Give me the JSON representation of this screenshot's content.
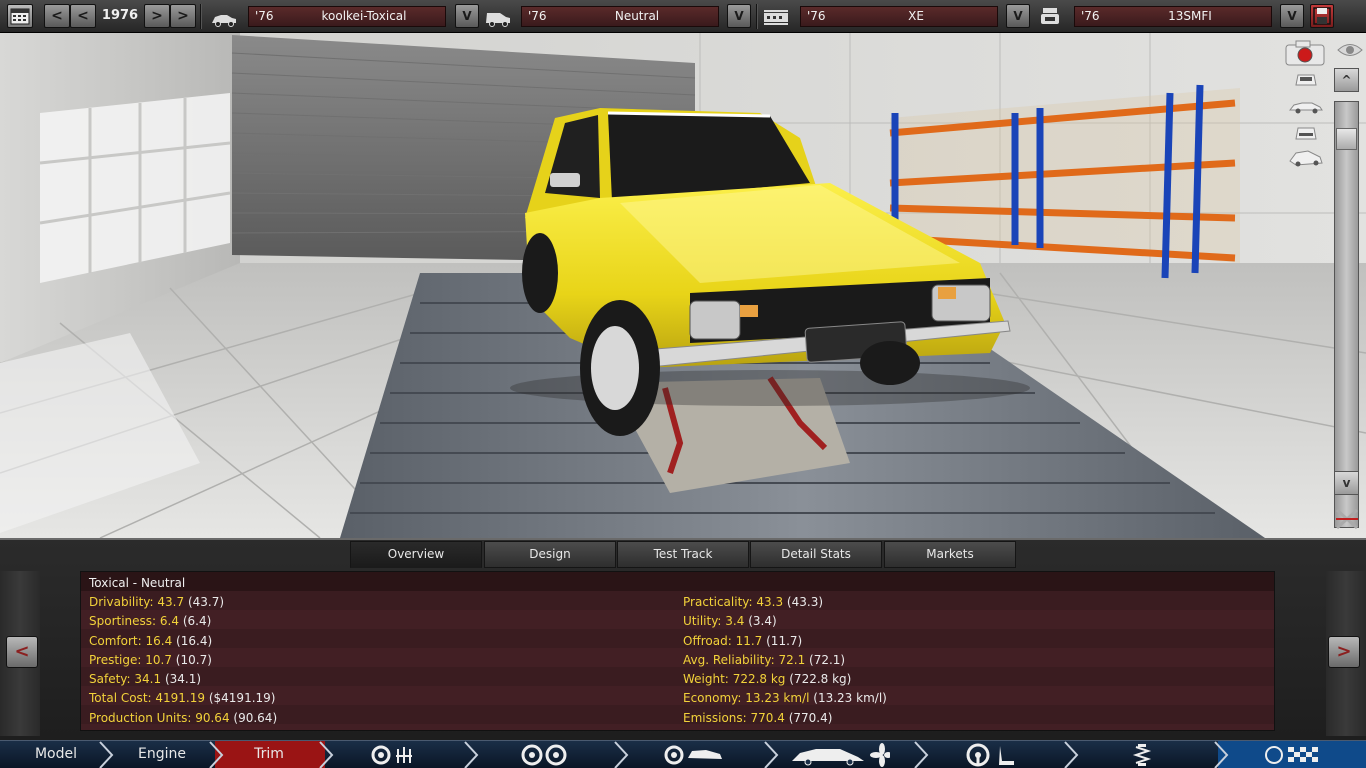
{
  "topbar": {
    "year": "1976",
    "prev_fast": "<",
    "prev": "<",
    "next": ">",
    "next_fast": ">",
    "dropdown": "V",
    "fields": [
      {
        "year": "'76",
        "name": "koolkei-Toxical"
      },
      {
        "year": "'76",
        "name": "Neutral"
      },
      {
        "year": "'76",
        "name": "XE"
      },
      {
        "year": "'76",
        "name": "13SMFI"
      }
    ]
  },
  "scene": {
    "scroll_up": "^",
    "scroll_down": "v"
  },
  "tabs": [
    "Overview",
    "Design",
    "Test Track",
    "Detail Stats",
    "Markets"
  ],
  "active_tab": "Overview",
  "stats": {
    "title": "Toxical - Neutral",
    "left": [
      {
        "label": "Drivability:",
        "value": "43.7",
        "paren": "(43.7)"
      },
      {
        "label": "Sportiness:",
        "value": "6.4",
        "paren": "(6.4)"
      },
      {
        "label": "Comfort:",
        "value": "16.4",
        "paren": "(16.4)"
      },
      {
        "label": "Prestige:",
        "value": "10.7",
        "paren": "(10.7)"
      },
      {
        "label": "Safety:",
        "value": "34.1",
        "paren": "(34.1)"
      },
      {
        "label": "Total Cost:",
        "value": "4191.19",
        "paren": "($4191.19)"
      },
      {
        "label": "Production Units:",
        "value": "90.64",
        "paren": "(90.64)"
      }
    ],
    "right": [
      {
        "label": "Practicality:",
        "value": "43.3",
        "paren": "(43.3)"
      },
      {
        "label": "Utility:",
        "value": "3.4",
        "paren": "(3.4)"
      },
      {
        "label": "Offroad:",
        "value": "11.7",
        "paren": "(11.7)"
      },
      {
        "label": "Avg. Reliability:",
        "value": "72.1",
        "paren": "(72.1)"
      },
      {
        "label": "Weight:",
        "value": "722.8 kg",
        "paren": "(722.8 kg)"
      },
      {
        "label": "Economy:",
        "value": "13.23 km/l",
        "paren": "(13.23 km/l)"
      },
      {
        "label": "Emissions:",
        "value": "770.4",
        "paren": "(770.4)"
      }
    ]
  },
  "side": {
    "prev": "<",
    "next": ">"
  },
  "nav": {
    "model": "Model",
    "engine": "Engine",
    "trim": "Trim"
  },
  "colors": {
    "accent_red": "#b01a1a",
    "stat_yellow": "#f2d23a",
    "panel_maroon": "#3a1c20",
    "car_yellow": "#f0e020"
  }
}
